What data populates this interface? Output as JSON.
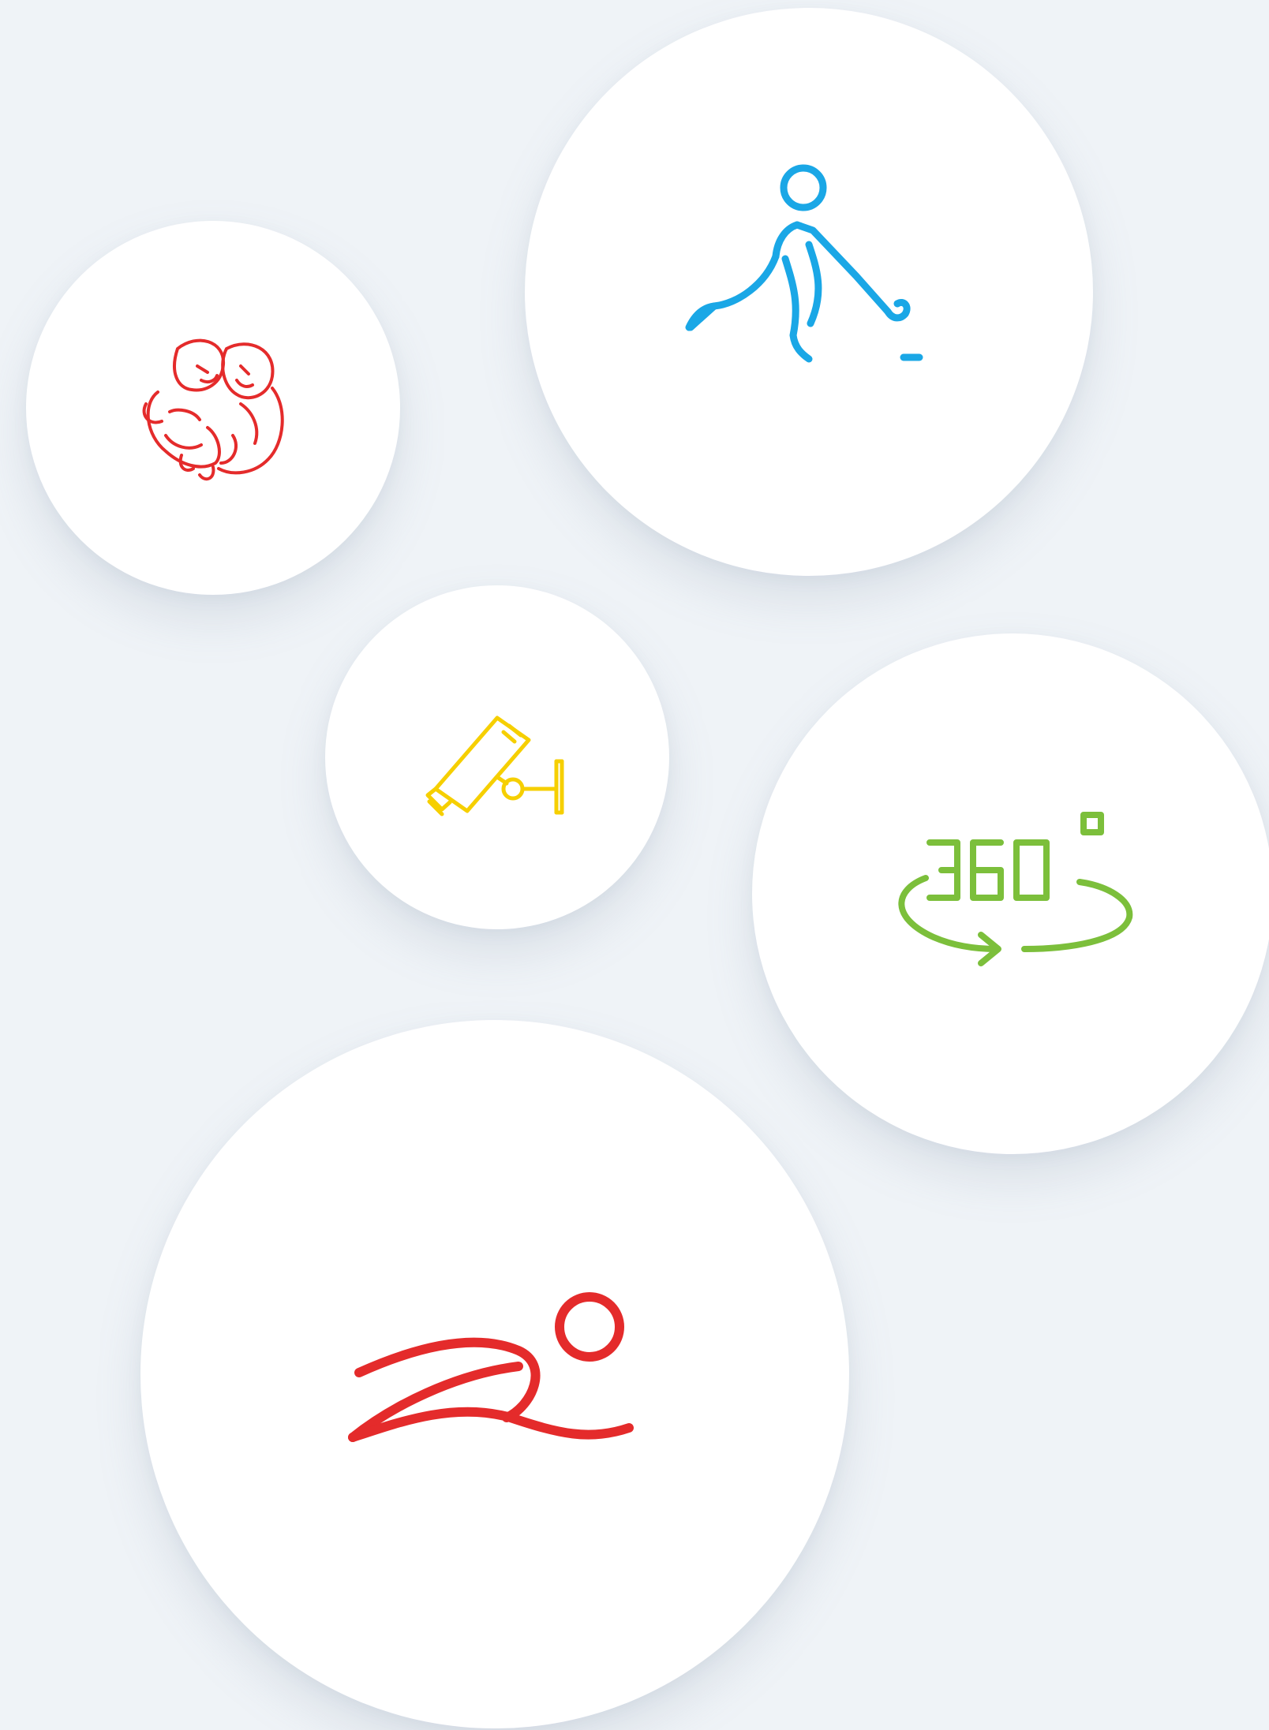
{
  "colors": {
    "background": "#eff3f7",
    "bubble": "#ffffff",
    "red": "#e42b2b",
    "blue": "#1aa7e6",
    "yellow": "#f6cf00",
    "green": "#7cbf3b"
  },
  "bubbles": [
    {
      "id": "twins",
      "icon": "twin-babies-icon"
    },
    {
      "id": "hockey",
      "icon": "hockey-player-icon"
    },
    {
      "id": "camera",
      "icon": "security-camera-icon"
    },
    {
      "id": "view360",
      "icon": "rotate-360-icon",
      "label": "360"
    },
    {
      "id": "swim",
      "icon": "swimmer-icon"
    }
  ]
}
